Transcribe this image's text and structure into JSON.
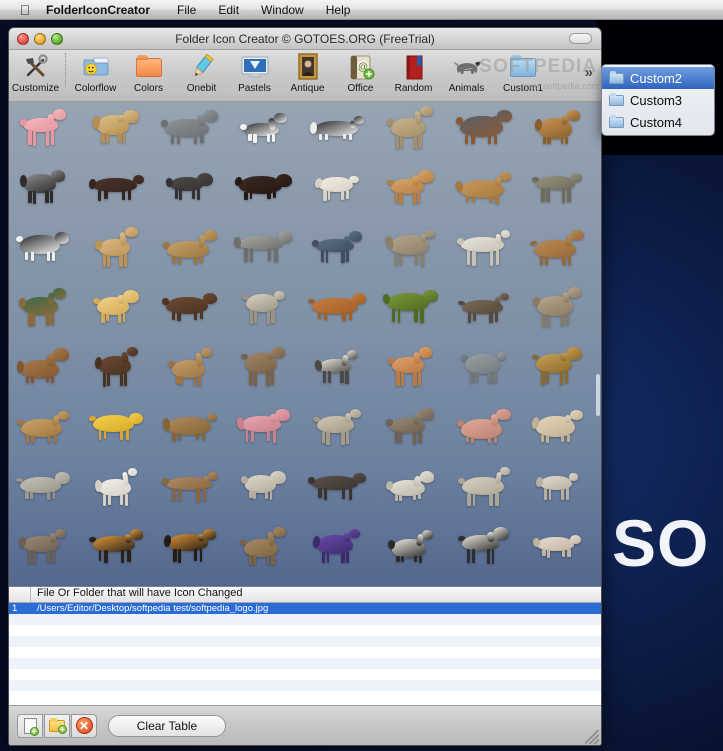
{
  "menubar": {
    "apple_icon": "apple-logo",
    "app_name": "FolderIconCreator",
    "items": [
      {
        "label": "File"
      },
      {
        "label": "Edit"
      },
      {
        "label": "Window"
      },
      {
        "label": "Help"
      }
    ]
  },
  "window": {
    "title": "Folder Icon Creator © GOTOES.ORG (FreeTrial)",
    "controls": {
      "close": "close-button",
      "minimize": "minimize-button",
      "zoom": "zoom-button"
    }
  },
  "toolbar": {
    "items": [
      {
        "label": "Customize",
        "icon": "hammer-wrench-icon"
      },
      {
        "label": "Colorflow",
        "icon": "smiley-folder-icon"
      },
      {
        "label": "Colors",
        "icon": "orange-folder-icon"
      },
      {
        "label": "Onebit",
        "icon": "pencil-icon"
      },
      {
        "label": "Pastels",
        "icon": "monitor-icon"
      },
      {
        "label": "Antique",
        "icon": "framed-portrait-icon"
      },
      {
        "label": "Office",
        "icon": "address-book-icon"
      },
      {
        "label": "Random",
        "icon": "red-book-icon"
      },
      {
        "label": "Animals",
        "icon": "dog-icon"
      },
      {
        "label": "Custom1",
        "icon": "blue-folder-icon"
      }
    ],
    "overflow_chevron": "»",
    "watermark": "SOFTPEDIA",
    "watermark_url": "www.softpedia.com"
  },
  "overflow_menu": {
    "items": [
      {
        "label": "Custom2",
        "icon": "folder-icon",
        "selected": true
      },
      {
        "label": "Custom3",
        "icon": "folder-icon",
        "selected": false
      },
      {
        "label": "Custom4",
        "icon": "folder-icon",
        "selected": false
      }
    ]
  },
  "icon_grid": {
    "columns": 8,
    "rows": 8,
    "icons": [
      "flamingo",
      "giraffe",
      "rhinoceros",
      "penguin",
      "penguin-2",
      "elephant",
      "grebe",
      "ocelot",
      "badger",
      "bear",
      "bison",
      "bull",
      "rabbit",
      "camel-calf",
      "camel",
      "cat-gray",
      "cow-black",
      "dog-golden",
      "fawn",
      "husky",
      "dolphin",
      "donkey",
      "sheep-white",
      "camel-brown",
      "mallard-duck",
      "teddy-bear",
      "grizzly-bear",
      "ferret",
      "fox",
      "frog",
      "foal",
      "goat",
      "horse-brown",
      "horse-dark",
      "gazelle",
      "kangaroo",
      "cat-calico",
      "cat-orange",
      "koala",
      "leopard",
      "lion-cub",
      "lion-plush",
      "lynx",
      "flamingo-2",
      "ram",
      "mule",
      "pig",
      "poodle",
      "rabbit-gray",
      "rabbit-white",
      "rabbit-brown",
      "sheep",
      "otter",
      "seal",
      "sheep-2",
      "lamb",
      "squirrel",
      "tiger-lying",
      "tiger-running",
      "elk",
      "whale-purple",
      "zebra",
      "zebra-2",
      "bull-white"
    ]
  },
  "table": {
    "headers": {
      "number": "",
      "path": "File Or Folder that will have Icon Changed"
    },
    "rows": [
      {
        "number": "1",
        "path": "/Users/Editor/Desktop/softpedia test/softpedia_logo.jpg",
        "selected": true
      }
    ],
    "empty_row_count": 8
  },
  "bottombar": {
    "add_file_button": "add-file-button",
    "add_folder_button": "add-folder-button",
    "remove_button": "remove-button",
    "remove_glyph": "✕",
    "plus_glyph": "+",
    "clear_table_label": "Clear Table"
  },
  "desktop": {
    "watermark": "SO"
  },
  "colors": {
    "selection_blue": "#2a6cd6",
    "menu_highlight": "#2f63bf",
    "grid_top": "#97a4b2",
    "grid_bottom": "#54688f",
    "desktop_navy": "#0d1f4c"
  }
}
